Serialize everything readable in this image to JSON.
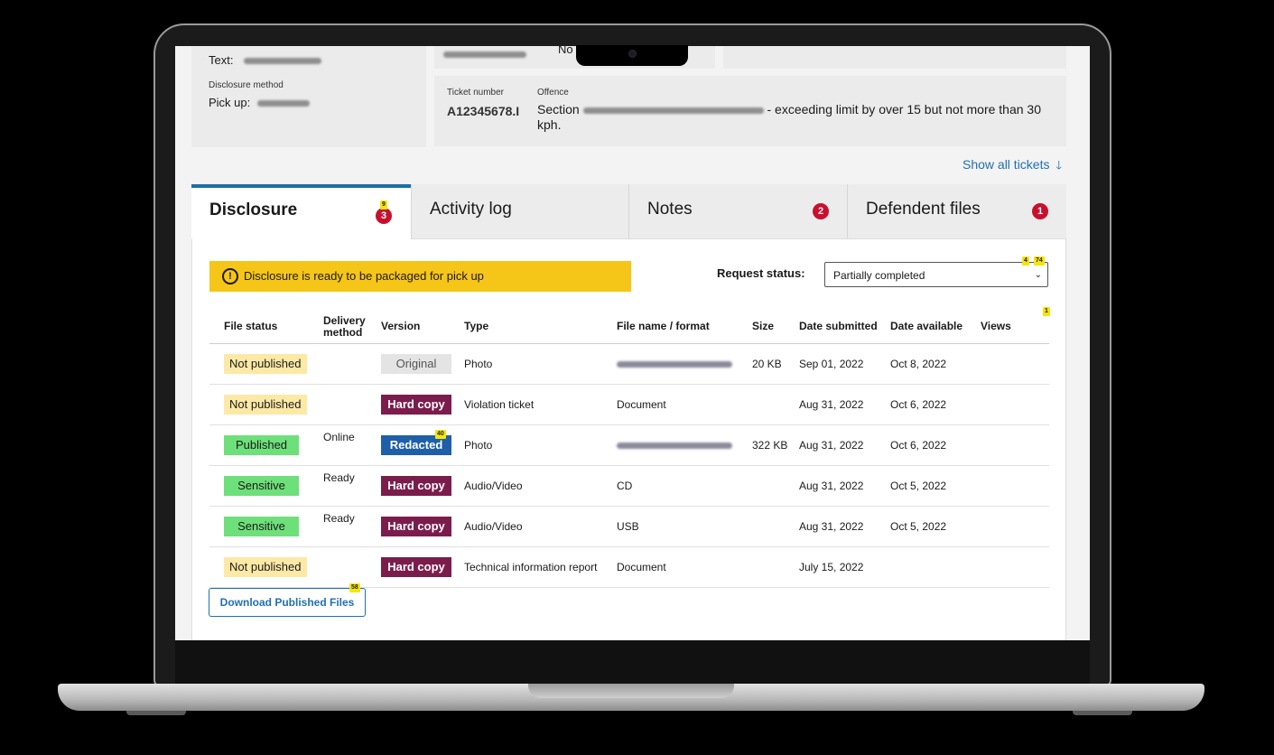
{
  "contact": {
    "text_label": "Text:",
    "disclosure_method_label": "Disclosure method",
    "pick_up_label": "Pick up:"
  },
  "ticket": {
    "no_label": "No",
    "ticket_number_label": "Ticket number",
    "ticket_number": "A12345678.I",
    "offence_label": "Offence",
    "offence_prefix": "Section",
    "offence_text": "- exceeding limit by over 15 but not more than 30 kph."
  },
  "show_all_tickets": "Show all tickets",
  "tabs": [
    {
      "label": "Disclosure",
      "badge": "3",
      "active": true
    },
    {
      "label": "Activity log",
      "badge": ""
    },
    {
      "label": "Notes",
      "badge": "2"
    },
    {
      "label": "Defendent files",
      "badge": "1"
    }
  ],
  "alert": {
    "text": "Disclosure is ready to be packaged for pick up"
  },
  "request_status": {
    "label": "Request status:",
    "value": "Partially completed"
  },
  "markers": {
    "tab": "9",
    "select_a": "4",
    "select_b": "74",
    "views": "1",
    "redacted": "40",
    "download": "58"
  },
  "table": {
    "headers": {
      "file_status": "File status",
      "delivery_method": "Delivery method",
      "version": "Version",
      "type": "Type",
      "file_name": "File name / format",
      "size": "Size",
      "date_submitted": "Date submitted",
      "date_available": "Date available",
      "views": "Views"
    },
    "rows": [
      {
        "status": "Not published",
        "status_kind": "np",
        "delivery": "",
        "version": "Original",
        "version_kind": "orig",
        "type": "Photo",
        "file": "",
        "file_blurred": true,
        "size": "20 KB",
        "submitted": "Sep 01, 2022",
        "available": "Oct 8, 2022",
        "views": ""
      },
      {
        "status": "Not published",
        "status_kind": "np",
        "delivery": "",
        "version": "Hard copy",
        "version_kind": "hard",
        "type": "Violation ticket",
        "file": "Document",
        "file_blurred": false,
        "size": "",
        "submitted": "Aug 31, 2022",
        "available": "Oct 6, 2022",
        "views": ""
      },
      {
        "status": "Published",
        "status_kind": "pub",
        "delivery": "Online",
        "version": "Redacted",
        "version_kind": "red",
        "type": "Photo",
        "file": "",
        "file_blurred": true,
        "size": "322 KB",
        "submitted": "Aug 31, 2022",
        "available": "Oct 6, 2022",
        "views": ""
      },
      {
        "status": "Sensitive",
        "status_kind": "pub",
        "delivery": "Ready",
        "version": "Hard copy",
        "version_kind": "hard",
        "type": "Audio/Video",
        "file": "CD",
        "file_blurred": false,
        "size": "",
        "submitted": "Aug 31, 2022",
        "available": "Oct 5, 2022",
        "views": ""
      },
      {
        "status": "Sensitive",
        "status_kind": "pub",
        "delivery": "Ready",
        "version": "Hard copy",
        "version_kind": "hard",
        "type": "Audio/Video",
        "file": "USB",
        "file_blurred": false,
        "size": "",
        "submitted": "Aug 31, 2022",
        "available": "Oct 5, 2022",
        "views": ""
      },
      {
        "status": "Not published",
        "status_kind": "np",
        "delivery": "",
        "version": "Hard copy",
        "version_kind": "hard",
        "type": "Technical information report",
        "file": "Document",
        "file_blurred": false,
        "size": "",
        "submitted": "July 15, 2022",
        "available": "",
        "views": ""
      }
    ]
  },
  "download_button": "Download Published Files",
  "colors": {
    "accent": "#1a6fa6",
    "alert": "#f5c518",
    "hard_copy": "#7b1d4c",
    "redacted": "#1f5fa8",
    "published": "#6ee07a",
    "not_published": "#fce9a6",
    "badge": "#c8102e"
  }
}
